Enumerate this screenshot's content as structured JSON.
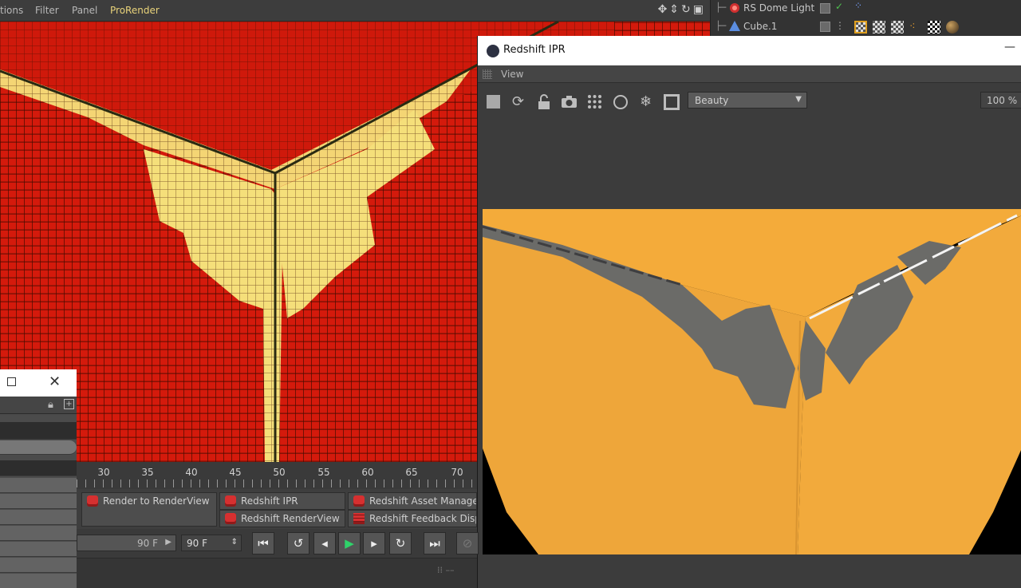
{
  "menubar": {
    "items": [
      "tions",
      "Filter",
      "Panel",
      "ProRender"
    ],
    "nav_icons": [
      "move-view-icon",
      "dolly-view-icon",
      "rotate-view-icon",
      "toggle-view-icon"
    ]
  },
  "object_manager": {
    "objects": [
      {
        "name": "RS Dome Light",
        "icon": "rs-light-icon"
      },
      {
        "name": "Cube.1",
        "icon": "cube-icon"
      }
    ]
  },
  "ipr_window": {
    "title": "Redshift IPR",
    "menu_view": "View",
    "aov_selected": "Beauty",
    "zoom": "100 %",
    "toolbar_icons": [
      "stop-icon",
      "refresh-icon",
      "lock-icon",
      "camera-icon",
      "grid-icon",
      "circle-icon",
      "snowflake-icon",
      "frame-icon"
    ]
  },
  "timeline": {
    "ticks": [
      "30",
      "35",
      "40",
      "45",
      "50",
      "55",
      "60",
      "65",
      "70"
    ]
  },
  "command_palette": {
    "buttons": [
      "Render to RenderView",
      "Redshift IPR",
      "Redshift Asset Manage",
      "Redshift RenderView",
      "Redshift Feedback Disp"
    ]
  },
  "transport": {
    "end_frame_a": "90 F",
    "end_frame_b": "90 F",
    "buttons": [
      "first-frame",
      "prev-key",
      "prev-frame",
      "play",
      "next-frame",
      "next-key",
      "last-frame"
    ]
  },
  "colors": {
    "viewport_red": "#d41a0c",
    "viewport_yellow": "#f5df7a",
    "render_orange": "#f3a93a",
    "render_shadow": "#6b6b68",
    "accent_menu": "#e9d37a"
  }
}
